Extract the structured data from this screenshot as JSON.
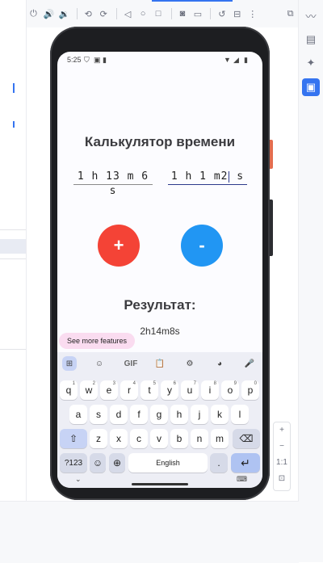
{
  "ide": {
    "toolbar_icons": [
      "power-icon",
      "volume-up-icon",
      "volume-down-icon",
      "rotate-left-icon",
      "rotate-right-icon",
      "back-icon",
      "home-icon",
      "overview-icon",
      "screenshot-icon",
      "screen-record-icon",
      "undo-icon",
      "ui-dump-icon",
      "more-icon",
      "snapshot-icon"
    ],
    "right_icons": [
      "device-explorer-icon",
      "device-manager-icon",
      "gemini-icon",
      "running-devices-icon"
    ],
    "zoom": {
      "in": "+",
      "out": "−",
      "actual": "1:1",
      "fit": "⊡"
    }
  },
  "status_bar": {
    "time": "5:25",
    "icons": [
      "shield-icon",
      "a-icon",
      "sim-icon",
      "wifi-icon",
      "signal-icon",
      "battery-icon"
    ]
  },
  "app": {
    "title": "Калькулятор времени",
    "input1": "1 h 13 m 6 s",
    "input2_before_cursor": "1 h 1 m2",
    "input2_after_cursor": " s",
    "plus_label": "+",
    "minus_label": "-",
    "result_label": "Результат:",
    "result_value": "2h14m8s",
    "colors": {
      "plus": "#f44336",
      "minus": "#2196f3"
    }
  },
  "keyboard": {
    "feature_chip": "See more features",
    "toolbar": [
      "grid-icon",
      "sticker-icon",
      "GIF",
      "clipboard-icon",
      "settings-icon",
      "palette-icon",
      "mic-icon"
    ],
    "gif_label": "GIF",
    "row1": [
      {
        "k": "q",
        "n": "1"
      },
      {
        "k": "w",
        "n": "2"
      },
      {
        "k": "e",
        "n": "3"
      },
      {
        "k": "r",
        "n": "4"
      },
      {
        "k": "t",
        "n": "5"
      },
      {
        "k": "y",
        "n": "6"
      },
      {
        "k": "u",
        "n": "7"
      },
      {
        "k": "i",
        "n": "8"
      },
      {
        "k": "o",
        "n": "9"
      },
      {
        "k": "p",
        "n": "0"
      }
    ],
    "row2": [
      "a",
      "s",
      "d",
      "f",
      "g",
      "h",
      "j",
      "k",
      "l"
    ],
    "row3": [
      "z",
      "x",
      "c",
      "v",
      "b",
      "n",
      "m"
    ],
    "symbols_label": "?123",
    "emoji_label": "☺",
    "comma_label": ",",
    "space_label": "English",
    "period_label": ".",
    "enter_label": "↵"
  }
}
